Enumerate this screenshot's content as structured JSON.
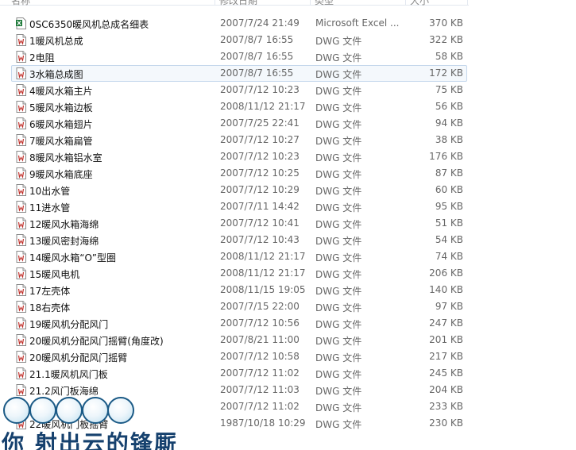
{
  "header": {
    "name": "名称",
    "date": "修改日期",
    "type": "类型",
    "size": "大小"
  },
  "files": [
    {
      "name": "0SC6350暖风机总成名细表",
      "date": "2007/7/24 21:49",
      "type": "Microsoft Excel ...",
      "size": "370 KB",
      "icon": "excel-file-icon"
    },
    {
      "name": "1暖风机总成",
      "date": "2007/8/7 16:55",
      "type": "DWG 文件",
      "size": "322 KB",
      "icon": "dwg-file-icon"
    },
    {
      "name": "2电阻",
      "date": "2007/8/7 16:55",
      "type": "DWG 文件",
      "size": "58 KB",
      "icon": "dwg-file-icon"
    },
    {
      "name": "3水箱总成图",
      "date": "2007/8/7 16:55",
      "type": "DWG 文件",
      "size": "172 KB",
      "icon": "dwg-file-icon"
    },
    {
      "name": "4暖风水箱主片",
      "date": "2007/7/12 10:23",
      "type": "DWG 文件",
      "size": "75 KB",
      "icon": "dwg-file-icon"
    },
    {
      "name": "5暖风水箱边板",
      "date": "2008/11/12 21:17",
      "type": "DWG 文件",
      "size": "56 KB",
      "icon": "dwg-file-icon"
    },
    {
      "name": "6暖风水箱翅片",
      "date": "2007/7/25 22:41",
      "type": "DWG 文件",
      "size": "94 KB",
      "icon": "dwg-file-icon"
    },
    {
      "name": "7暖风水箱扁管",
      "date": "2007/7/12 10:27",
      "type": "DWG 文件",
      "size": "38 KB",
      "icon": "dwg-file-icon"
    },
    {
      "name": "8暖风水箱铝水室",
      "date": "2007/7/12 10:23",
      "type": "DWG 文件",
      "size": "176 KB",
      "icon": "dwg-file-icon"
    },
    {
      "name": "9暖风水箱底座",
      "date": "2007/7/12 10:25",
      "type": "DWG 文件",
      "size": "87 KB",
      "icon": "dwg-file-icon"
    },
    {
      "name": "10出水管",
      "date": "2007/7/12 10:29",
      "type": "DWG 文件",
      "size": "60 KB",
      "icon": "dwg-file-icon"
    },
    {
      "name": "11进水管",
      "date": "2007/7/11 14:42",
      "type": "DWG 文件",
      "size": "95 KB",
      "icon": "dwg-file-icon"
    },
    {
      "name": "12暖风水箱海绵",
      "date": "2007/7/12 10:41",
      "type": "DWG 文件",
      "size": "51 KB",
      "icon": "dwg-file-icon"
    },
    {
      "name": "13暖风密封海绵",
      "date": "2007/7/12 10:43",
      "type": "DWG 文件",
      "size": "54 KB",
      "icon": "dwg-file-icon"
    },
    {
      "name": "14暖风水箱“O”型圈",
      "date": "2008/11/12 21:17",
      "type": "DWG 文件",
      "size": "74 KB",
      "icon": "dwg-file-icon"
    },
    {
      "name": "15暖风电机",
      "date": "2008/11/12 21:17",
      "type": "DWG 文件",
      "size": "206 KB",
      "icon": "dwg-file-icon"
    },
    {
      "name": "17左壳体",
      "date": "2008/11/15 19:05",
      "type": "DWG 文件",
      "size": "140 KB",
      "icon": "dwg-file-icon"
    },
    {
      "name": "18右壳体",
      "date": "2007/7/15 22:00",
      "type": "DWG 文件",
      "size": "97 KB",
      "icon": "dwg-file-icon"
    },
    {
      "name": "19暖风机分配风门",
      "date": "2007/7/12 10:56",
      "type": "DWG 文件",
      "size": "247 KB",
      "icon": "dwg-file-icon"
    },
    {
      "name": "20暖风机分配风门摇臂(角度改)",
      "date": "2007/8/21 11:00",
      "type": "DWG 文件",
      "size": "201 KB",
      "icon": "dwg-file-icon"
    },
    {
      "name": "20暖风机分配风门摇臂",
      "date": "2007/7/12 10:58",
      "type": "DWG 文件",
      "size": "217 KB",
      "icon": "dwg-file-icon"
    },
    {
      "name": "21.1暖风机风门板",
      "date": "2007/7/12 11:02",
      "type": "DWG 文件",
      "size": "245 KB",
      "icon": "dwg-file-icon"
    },
    {
      "name": "21.2风门板海绵",
      "date": "2007/7/12 11:03",
      "type": "DWG 文件",
      "size": "204 KB",
      "icon": "dwg-file-icon"
    },
    {
      "name": "",
      "date": "2007/7/12 11:02",
      "type": "DWG 文件",
      "size": "233 KB",
      "icon": "dwg-file-icon"
    },
    {
      "name": "22暖风机门板摇臂",
      "date": "1987/10/18 10:29",
      "type": "DWG 文件",
      "size": "230 KB",
      "icon": "dwg-file-icon"
    }
  ],
  "selected_index": 3,
  "overlay_caption": "你  射出云的锋厮",
  "colors": {
    "selection_bg": "#f4f8fc",
    "selection_border": "#c5d7ec",
    "caption": "#16416e",
    "bubble_border": "#1b5a86"
  }
}
